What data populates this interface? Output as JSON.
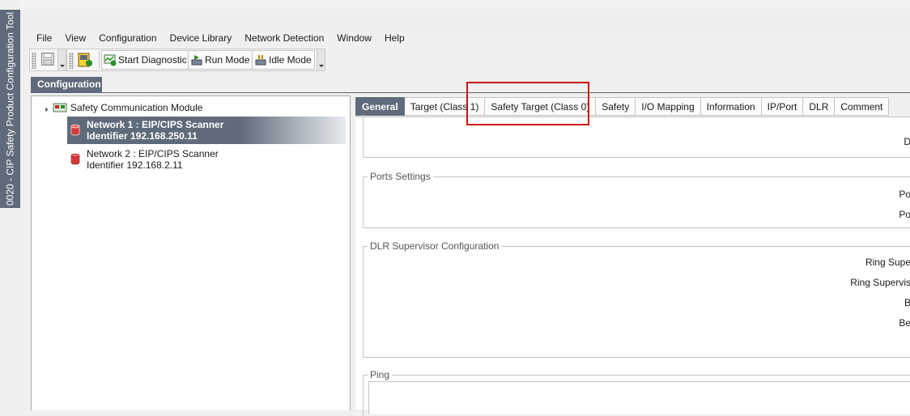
{
  "app": {
    "vertical_title": "0020 - CIP Safety Product Configuration Tool"
  },
  "menu": [
    "File",
    "View",
    "Configuration",
    "Device Library",
    "Network Detection",
    "Window",
    "Help"
  ],
  "toolbar": {
    "start_diagnostic": "Start Diagnostic",
    "run_mode": "Run Mode",
    "idle_mode": "Idle Mode"
  },
  "configuration_panel": {
    "header": "Configuration",
    "tree": {
      "root": "Safety Communication Module",
      "networks": [
        {
          "line1": "Network 1 : EIP/CIPS Scanner",
          "line2": "Identifier 192.168.250.11",
          "selected": true
        },
        {
          "line1": "Network 2 : EIP/CIPS Scanner",
          "line2": "Identifier 192.168.2.11",
          "selected": false
        }
      ]
    }
  },
  "tabs": [
    {
      "label": "General",
      "active": true
    },
    {
      "label": "Target (Class 1)",
      "active": false
    },
    {
      "label": "Safety Target (Class 0)",
      "active": false
    },
    {
      "label": "Safety",
      "active": false
    },
    {
      "label": "I/O Mapping",
      "active": false
    },
    {
      "label": "Information",
      "active": false
    },
    {
      "label": "IP/Port",
      "active": false
    },
    {
      "label": "DLR",
      "active": false
    },
    {
      "label": "Comment",
      "active": false
    }
  ],
  "general": {
    "top_group_label": "D",
    "ports_settings": {
      "title": "Ports Settings",
      "labels": [
        "Po",
        "Po"
      ]
    },
    "dlr_supervisor": {
      "title": "DLR Supervisor Configuration",
      "labels": [
        "Ring Supe",
        "Ring Supervis",
        "B",
        "Be"
      ]
    },
    "ping": {
      "title": "Ping"
    }
  },
  "colors": {
    "accent": "#5f6b7a",
    "highlight": "#cc1111"
  }
}
